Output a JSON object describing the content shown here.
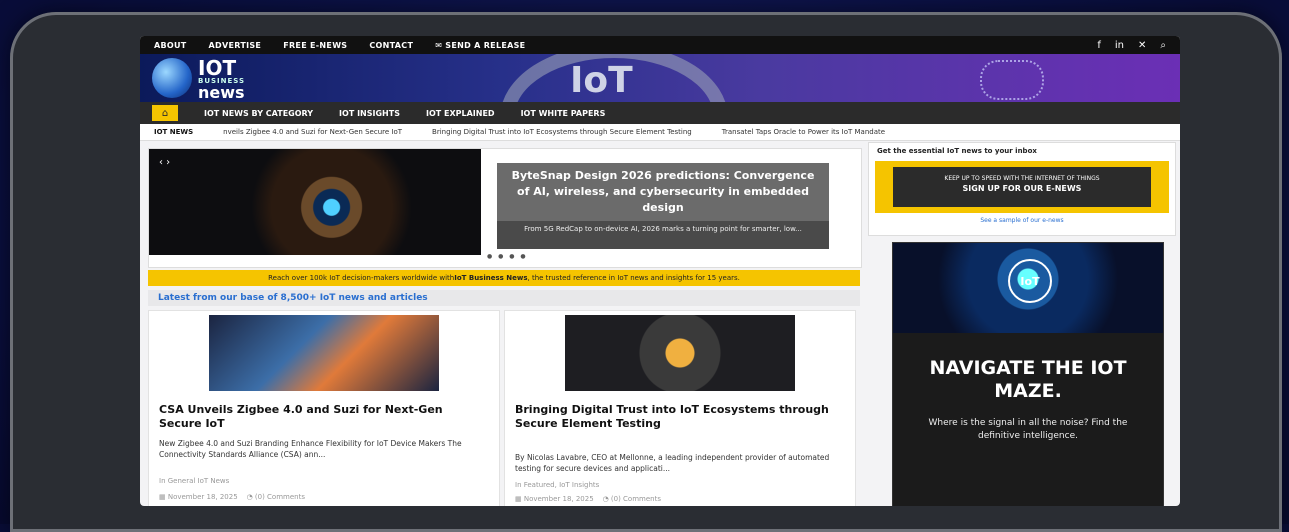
{
  "top_links": [
    "ABOUT",
    "ADVERTISE",
    "FREE E-NEWS",
    "CONTACT",
    "SEND A RELEASE"
  ],
  "social_icons": [
    "facebook-icon",
    "linkedin-icon",
    "x-icon",
    "search-icon"
  ],
  "brand": {
    "line1": "IOT",
    "line2": "BUSINESS",
    "line3": "news",
    "banner_word": "IoT"
  },
  "nav": {
    "items": [
      "IOT NEWS BY CATEGORY",
      "IOT INSIGHTS",
      "IOT EXPLAINED",
      "IOT WHITE PAPERS"
    ]
  },
  "ticker": {
    "label": "IOT NEWS",
    "items": [
      "nveils Zigbee 4.0 and Suzi for Next-Gen Secure IoT",
      "Bringing Digital Trust into IoT Ecosystems through Secure Element Testing",
      "Transatel Taps Oracle to Power its IoT Mandate"
    ]
  },
  "hero": {
    "title": "ByteSnap Design 2026 predictions: Convergence of AI, wireless, and cybersecurity in embedded design",
    "excerpt": "From 5G RedCap to on-device AI, 2026 marks a turning point for smarter, low..."
  },
  "promo_bar": {
    "before": "Reach over 100k IoT decision-makers worldwide with ",
    "bold": "IoT Business News",
    "after": ", the trusted reference in IoT news and insights for 15 years."
  },
  "latest_heading": "Latest from our base of 8,500+ IoT news and articles",
  "articles": [
    {
      "title": "CSA Unveils Zigbee 4.0 and Suzi for Next-Gen Secure IoT",
      "desc": "New Zigbee 4.0 and Suzi Branding Enhance Flexibility for IoT Device Makers The Connectivity Standards Alliance (CSA) ann...",
      "category": "In General IoT News",
      "date": "November 18, 2025",
      "comments": "(0) Comments"
    },
    {
      "title": "Bringing Digital Trust into IoT Ecosystems through Secure Element Testing",
      "desc": "By Nicolas Lavabre, CEO at Mellonne, a leading independent provider of automated testing for secure devices and applicati...",
      "category": "In Featured, IoT Insights",
      "date": "November 18, 2025",
      "comments": "(0) Comments"
    }
  ],
  "sidebar": {
    "newsletter_heading": "Get the essential IoT news to your inbox",
    "newsletter_line1": "KEEP UP TO SPEED WITH THE INTERNET OF THINGS",
    "newsletter_line2": "SIGN UP FOR OUR E-NEWS",
    "sample_link": "See a sample of our e-news",
    "ad_badge": "IoT",
    "ad_title": "NAVIGATE THE IOT MAZE.",
    "ad_text": "Where is the signal in all the noise? Find the definitive intelligence."
  }
}
